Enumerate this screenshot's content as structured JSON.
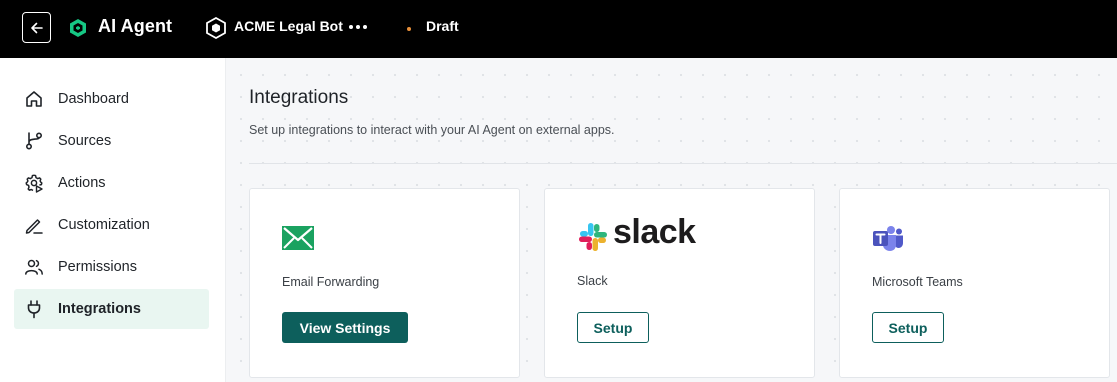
{
  "header": {
    "back_icon": "arrow-left-icon",
    "brand_icon": "hexagon-logo-icon",
    "brand_name": "AI Agent",
    "bot_icon": "hexagon-bot-icon",
    "bot_name": "ACME Legal Bot",
    "more_icon": "more-horizontal-icon",
    "status": "Draft",
    "status_color": "#e8903a"
  },
  "sidebar": {
    "items": [
      {
        "label": "Dashboard",
        "icon": "home-icon"
      },
      {
        "label": "Sources",
        "icon": "branch-icon"
      },
      {
        "label": "Actions",
        "icon": "gear-play-icon"
      },
      {
        "label": "Customization",
        "icon": "pen-icon"
      },
      {
        "label": "Permissions",
        "icon": "users-icon"
      },
      {
        "label": "Integrations",
        "icon": "plug-icon",
        "active": true
      }
    ]
  },
  "main": {
    "title": "Integrations",
    "subtitle": "Set up integrations to interact with your AI Agent on external apps."
  },
  "integrations": [
    {
      "name": "Email Forwarding",
      "logo": "email-icon",
      "button": "View Settings",
      "button_style": "primary"
    },
    {
      "name": "Slack",
      "logo": "slack-logo",
      "logo_text": "slack",
      "button": "Setup",
      "button_style": "outline"
    },
    {
      "name": "Microsoft Teams",
      "logo": "teams-icon",
      "button": "Setup",
      "button_style": "outline"
    }
  ],
  "colors": {
    "accent": "#0d5f5c",
    "active_bg": "#e9f6f1",
    "brand_green": "#16c784"
  }
}
